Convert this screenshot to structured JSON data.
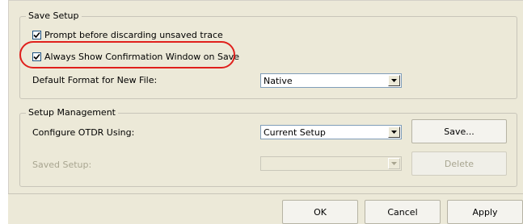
{
  "save_setup": {
    "legend": "Save Setup",
    "prompt_discard": {
      "label": "Prompt before discarding unsaved trace",
      "checked": true
    },
    "always_confirm": {
      "label": "Always Show Confirmation Window on Save",
      "checked": true
    },
    "default_format": {
      "label": "Default Format for New File:",
      "value": "Native"
    }
  },
  "setup_management": {
    "legend": "Setup Management",
    "configure": {
      "label": "Configure OTDR Using:",
      "value": "Current Setup"
    },
    "save_button": "Save...",
    "saved_setup": {
      "label": "Saved Setup:",
      "value": ""
    },
    "delete_button": "Delete"
  },
  "footer": {
    "ok": "OK",
    "cancel": "Cancel",
    "apply": "Apply"
  },
  "colors": {
    "panel": "#ece9d8",
    "highlight": "#e0201c",
    "disabled_text": "#a8a590"
  }
}
